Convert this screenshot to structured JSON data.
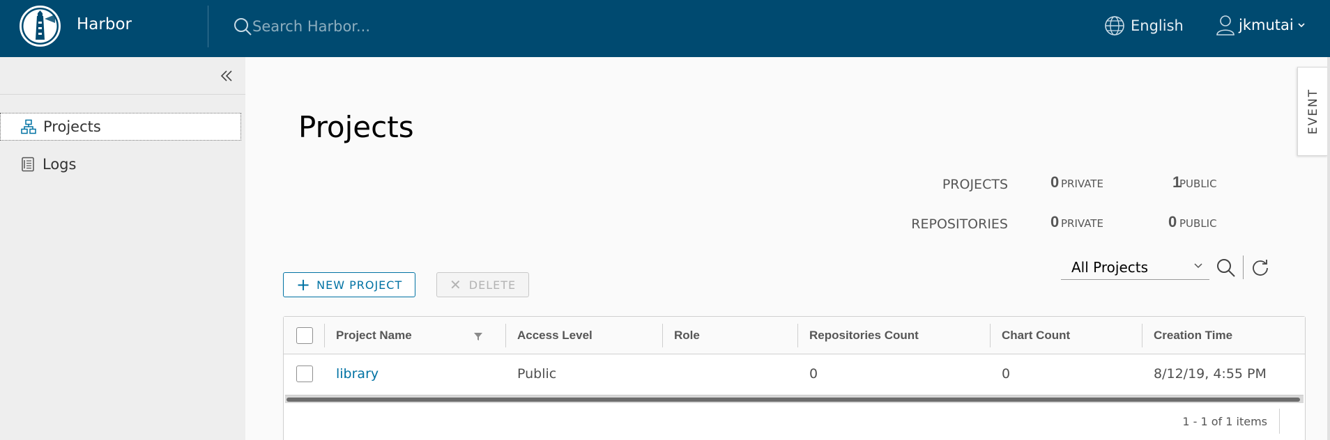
{
  "header": {
    "brand": "Harbor",
    "search_placeholder": "Search Harbor...",
    "language": "English",
    "username": "jkmutai",
    "background_color": "#004a70"
  },
  "sidebar": {
    "items": [
      {
        "label": "Projects",
        "icon": "organization-icon",
        "active": true
      },
      {
        "label": "Logs",
        "icon": "logs-icon",
        "active": false
      }
    ]
  },
  "main": {
    "title": "Projects",
    "summary": {
      "projects_label": "PROJECTS",
      "repositories_label": "REPOSITORIES",
      "private_label": "PRIVATE",
      "public_label": "PUBLIC",
      "projects_private": "0",
      "projects_public": "1",
      "repositories_private": "0",
      "repositories_public": "0"
    },
    "toolbar": {
      "new_project_label": "NEW PROJECT",
      "delete_label": "DELETE",
      "filter_selected": "All Projects"
    },
    "table": {
      "columns": [
        "Project Name",
        "Access Level",
        "Role",
        "Repositories Count",
        "Chart Count",
        "Creation Time"
      ],
      "rows": [
        {
          "name": "library",
          "access": "Public",
          "role": "",
          "repos": "0",
          "charts": "0",
          "created": "8/12/19, 4:55 PM"
        }
      ],
      "pagination": "1 - 1 of 1 items"
    },
    "event_tab": "EVENT",
    "accent_color": "#0072a3"
  }
}
